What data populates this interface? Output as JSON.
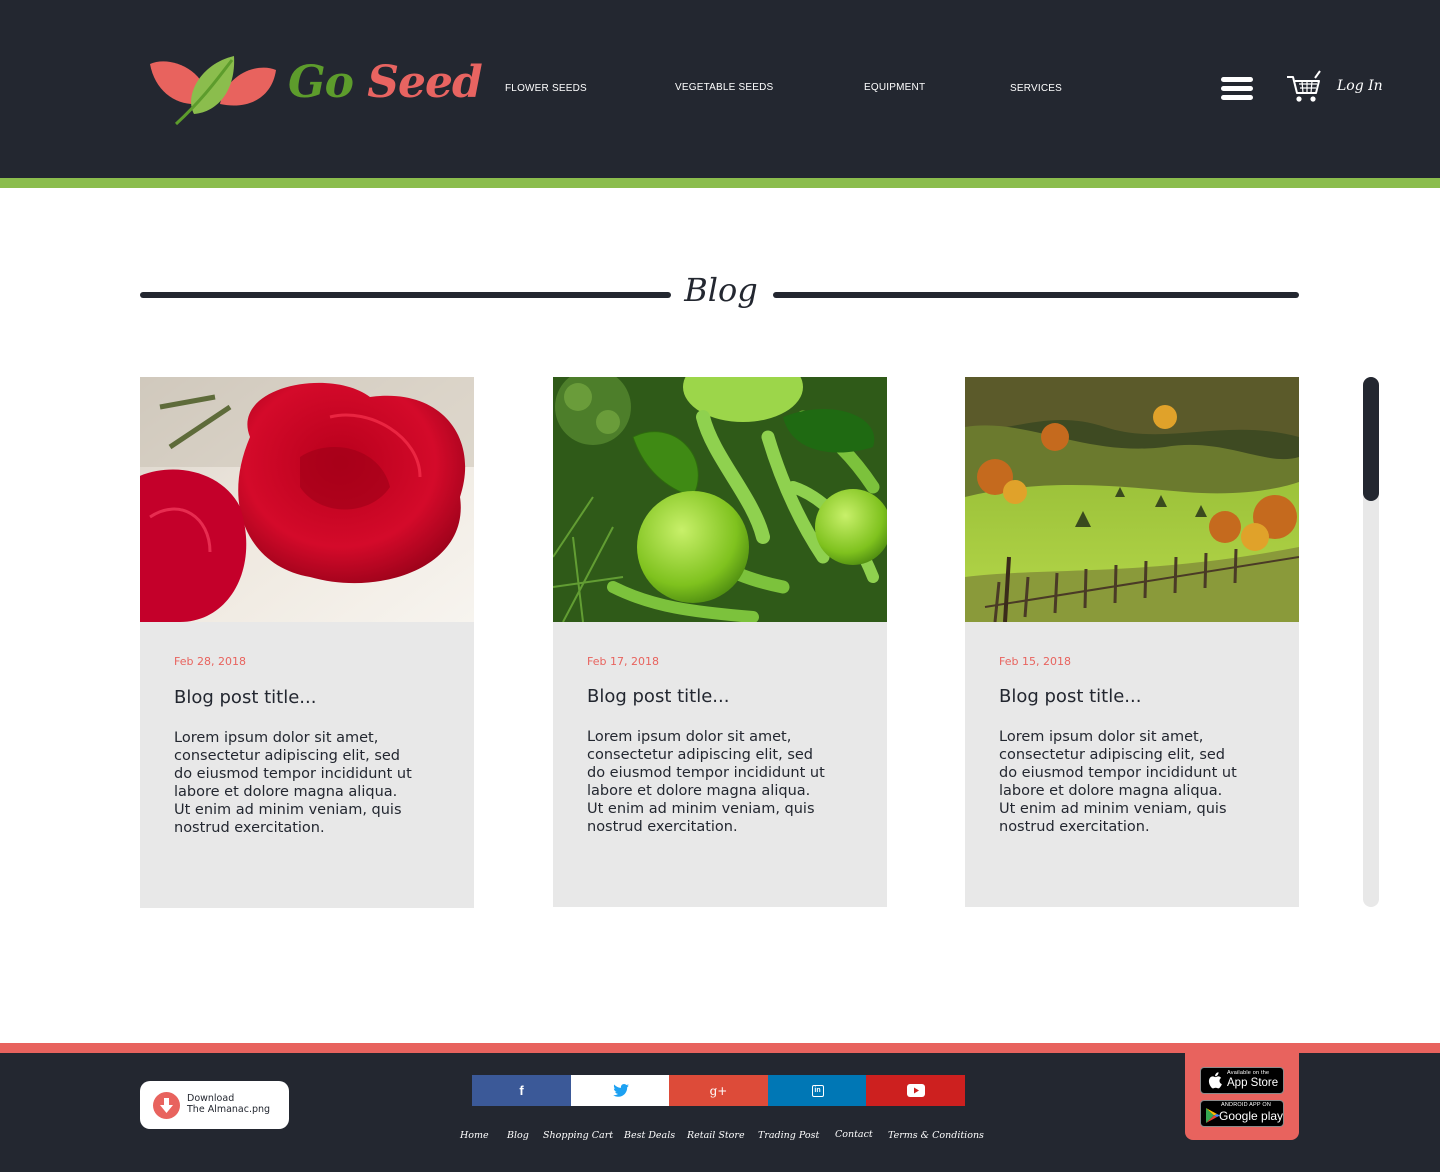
{
  "brand": {
    "name_part1": "Go",
    "name_part2": "Seed"
  },
  "nav": {
    "items": [
      "FLOWER SEEDS",
      "VEGETABLE SEEDS",
      "EQUIPMENT",
      "SERVICES"
    ],
    "login": "Log In"
  },
  "colors": {
    "header_bg": "#232730",
    "accent_green": "#8bbd4d",
    "accent_red": "#e8635e",
    "card_bg": "#e8e8e8"
  },
  "blog": {
    "title": "Blog",
    "posts": [
      {
        "date": "Feb 28, 2018",
        "title": "Blog post title...",
        "body": "Lorem ipsum dolor sit amet, consectetur adipiscing elit, sed do eiusmod tempor incididunt ut labore et dolore magna aliqua. Ut enim ad minim veniam, quis nostrud exercitation.",
        "image": "red-roses"
      },
      {
        "date": "Feb 17, 2018",
        "title": "Blog post title...",
        "body": "Lorem ipsum dolor sit amet, consectetur adipiscing elit, sed do eiusmod tempor incididunt ut labore et dolore magna aliqua. Ut enim ad minim veniam, quis nostrud exercitation.",
        "image": "green-vegetables"
      },
      {
        "date": "Feb 15, 2018",
        "title": "Blog post title...",
        "body": "Lorem ipsum dolor sit amet, consectetur adipiscing elit, sed do eiusmod tempor incididunt ut labore et dolore magna aliqua. Ut enim ad minim veniam, quis nostrud exercitation.",
        "image": "countryside-landscape"
      }
    ]
  },
  "footer": {
    "download": {
      "line1": "Download",
      "line2": "The Almanac.png"
    },
    "social": [
      {
        "name": "facebook-icon",
        "glyph": "f",
        "color": "#3b5998"
      },
      {
        "name": "twitter-icon",
        "glyph": "",
        "color": "#ffffff"
      },
      {
        "name": "google-plus-icon",
        "glyph": "g+",
        "color": "#dd4b39"
      },
      {
        "name": "linkedin-icon",
        "glyph": "in",
        "color": "#0077b5"
      },
      {
        "name": "youtube-icon",
        "glyph": "",
        "color": "#cd201f"
      }
    ],
    "links": [
      "Home",
      "Blog",
      "Shopping Cart",
      "Best Deals",
      "Retail Store",
      "Trading Post",
      "Contact",
      "Terms & Conditions"
    ],
    "app_store": {
      "small": "Available on the",
      "big": "App Store"
    },
    "google_play": {
      "small": "ANDROID APP ON",
      "big": "Google play"
    }
  }
}
